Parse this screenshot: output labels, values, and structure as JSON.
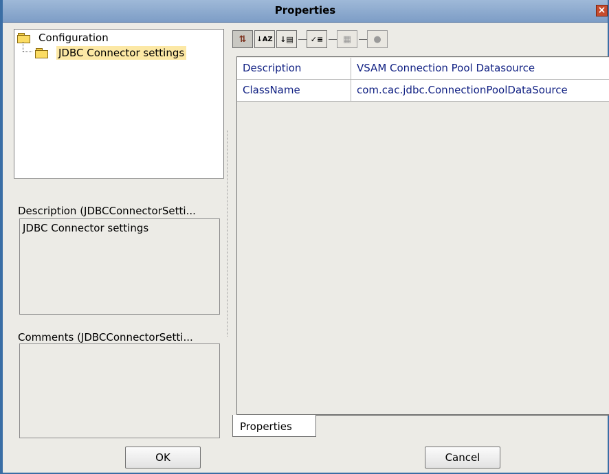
{
  "window": {
    "title": "Properties",
    "close_glyph": "×"
  },
  "tree": {
    "root": {
      "label": "Configuration",
      "icon": "folder-icon"
    },
    "child": {
      "label": "JDBC Connector settings",
      "icon": "folder-icon"
    }
  },
  "description": {
    "label": "Description (JDBCConnectorSetti...",
    "value": "JDBC Connector settings"
  },
  "comments": {
    "label": "Comments (JDBCConnectorSetti...",
    "value": ""
  },
  "toolbar": {
    "buttons": [
      {
        "name": "unsorted-icon",
        "glyph": "⇅"
      },
      {
        "name": "sort-by-name-icon",
        "glyph": "↓AZ"
      },
      {
        "name": "sort-by-type-icon",
        "glyph": "↓▤"
      },
      {
        "name": "show-editable-icon",
        "glyph": "✓≡"
      },
      {
        "name": "custom-editor-icon",
        "glyph": "▦"
      },
      {
        "name": "help-icon",
        "glyph": "●"
      }
    ]
  },
  "properties": {
    "rows": [
      {
        "name": "Description",
        "value": "VSAM Connection Pool Datasource"
      },
      {
        "name": "ClassName",
        "value": "com.cac.jdbc.ConnectionPoolDataSource"
      }
    ]
  },
  "tabs": [
    {
      "label": "Properties"
    }
  ],
  "buttons": {
    "ok": "OK",
    "cancel": "Cancel"
  },
  "colors": {
    "title_bar": "#8aa8cf",
    "selection": "#fce8a5",
    "property_text": "#0f1f82",
    "window_bg": "#ecebe6"
  }
}
